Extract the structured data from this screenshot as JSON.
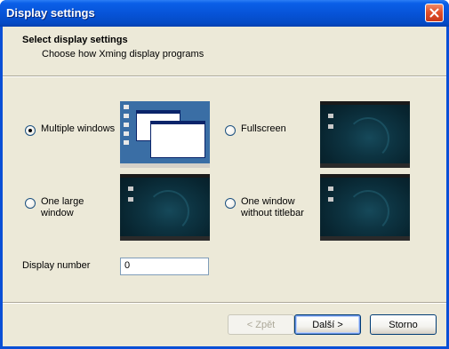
{
  "window": {
    "title": "Display settings"
  },
  "header": {
    "title": "Select display settings",
    "subtitle": "Choose how Xming display programs"
  },
  "options": {
    "multiple_windows": "Multiple windows",
    "fullscreen": "Fullscreen",
    "one_large_window_line1": "One large",
    "one_large_window_line2": "window",
    "one_window_no_titlebar_line1": "One window",
    "one_window_no_titlebar_line2": "without titlebar",
    "selected": "Multiple windows"
  },
  "display_number": {
    "label": "Display number",
    "value": "0"
  },
  "buttons": {
    "back": "< Zpět",
    "next": "Další >",
    "cancel": "Storno"
  },
  "icons": {
    "close": "close-icon"
  }
}
